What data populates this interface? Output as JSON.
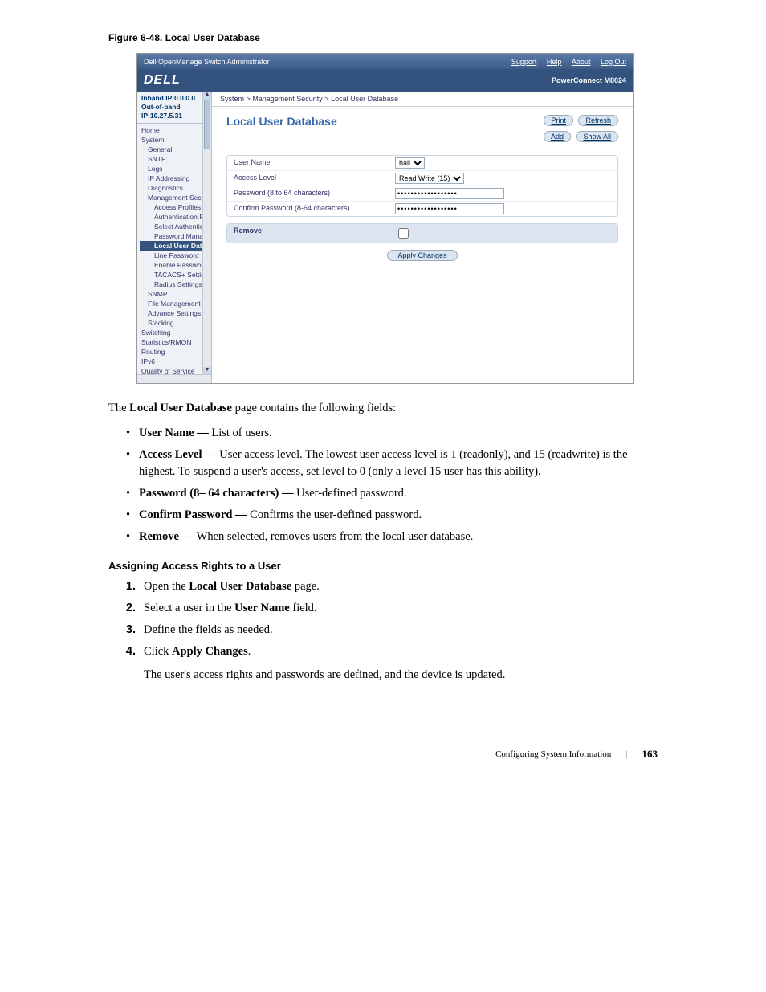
{
  "figure_caption": "Figure 6-48.    Local User Database",
  "screenshot": {
    "titlebar_left": "Dell OpenManage Switch Administrator",
    "titlebar_links": [
      "Support",
      "Help",
      "About",
      "Log Out"
    ],
    "logo": "DELL",
    "model": "PowerConnect M8024",
    "ip_inband": "Inband IP:0.0.0.0",
    "ip_outband": "Out-of-band IP:10.27.5.31",
    "tree": [
      {
        "l": "l1",
        "t": "Home"
      },
      {
        "l": "l1",
        "t": "System"
      },
      {
        "l": "l2",
        "t": "General"
      },
      {
        "l": "l2",
        "t": "SNTP"
      },
      {
        "l": "l2",
        "t": "Logs"
      },
      {
        "l": "l2",
        "t": "IP Addressing"
      },
      {
        "l": "l2",
        "t": "Diagnostics"
      },
      {
        "l": "l2",
        "t": "Management Secur"
      },
      {
        "l": "l3",
        "t": "Access Profiles"
      },
      {
        "l": "l3",
        "t": "Authentication P"
      },
      {
        "l": "l3",
        "t": "Select Authentic"
      },
      {
        "l": "l3",
        "t": "Password Manag"
      },
      {
        "l": "l3",
        "t": "Local User Data",
        "sel": true
      },
      {
        "l": "l3",
        "t": "Line Password"
      },
      {
        "l": "l3",
        "t": "Enable Passwor"
      },
      {
        "l": "l3",
        "t": "TACACS+ Settin"
      },
      {
        "l": "l3",
        "t": "Radius Settings"
      },
      {
        "l": "l2",
        "t": "SNMP"
      },
      {
        "l": "l2",
        "t": "File Management"
      },
      {
        "l": "l2",
        "t": "Advance Settings"
      },
      {
        "l": "l2",
        "t": "Stacking"
      },
      {
        "l": "l1",
        "t": "Switching"
      },
      {
        "l": "l1",
        "t": "Statistics/RMON"
      },
      {
        "l": "l1",
        "t": "Routing"
      },
      {
        "l": "l1",
        "t": "IPv6"
      },
      {
        "l": "l1",
        "t": "Quality of Service"
      }
    ],
    "breadcrumb": "System > Management Security > Local User Database",
    "page_title": "Local User Database",
    "buttons": {
      "print": "Print",
      "refresh": "Refresh",
      "add": "Add",
      "showall": "Show All"
    },
    "fields": {
      "user_name_label": "User Name",
      "user_name_value": "hall",
      "access_level_label": "Access Level",
      "access_level_value": "Read Write (15)",
      "password_label": "Password (8 to 64 characters)",
      "confirm_label": "Confirm Password (8-64 characters)",
      "remove_label": "Remove"
    },
    "apply": "Apply Changes"
  },
  "intro_prefix": "The ",
  "intro_bold": "Local User Database",
  "intro_suffix": " page contains the following fields:",
  "bullets": [
    {
      "b": "User Name — ",
      "t": "List of users."
    },
    {
      "b": "Access Level — ",
      "t": "User access level. The lowest user access level is 1 (readonly), and 15 (readwrite) is the highest. To suspend a user's access, set level to 0 (only a level 15 user has this ability)."
    },
    {
      "b": "Password (8– 64 characters) — ",
      "t": "User-defined password."
    },
    {
      "b": "Confirm Password — ",
      "t": "Confirms the user-defined password."
    },
    {
      "b": "Remove — ",
      "t": "When selected, removes users from the local user database."
    }
  ],
  "section_head": "Assigning Access Rights to a User",
  "steps": [
    {
      "pre": "Open the ",
      "b": "Local User Database",
      "post": " page."
    },
    {
      "pre": "Select a user in the ",
      "b": "User Name",
      "post": " field."
    },
    {
      "pre": "Define the fields as needed.",
      "b": "",
      "post": ""
    },
    {
      "pre": "Click ",
      "b": "Apply Changes",
      "post": "."
    }
  ],
  "step_followup": "The user's access rights and passwords are defined, and the device is updated.",
  "footer_section": "Configuring System Information",
  "footer_page": "163"
}
